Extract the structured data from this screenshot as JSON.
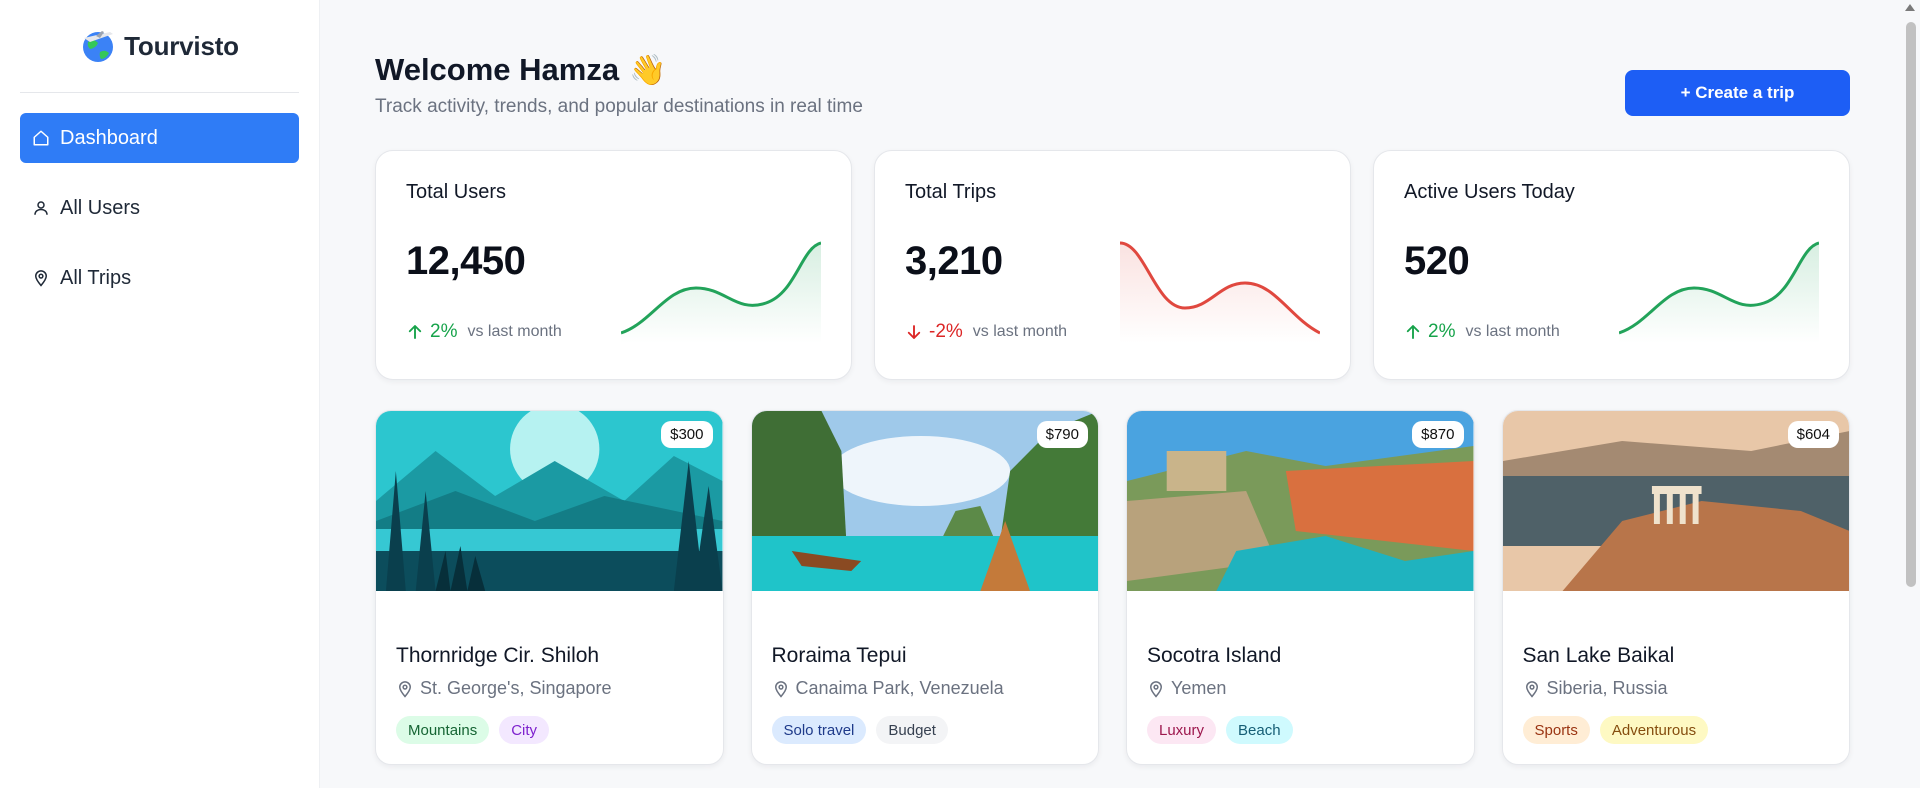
{
  "brand": {
    "name": "Tourvisto"
  },
  "sidebar": {
    "items": [
      {
        "label": "Dashboard",
        "icon": "home-icon",
        "active": true
      },
      {
        "label": "All Users",
        "icon": "user-icon",
        "active": false
      },
      {
        "label": "All Trips",
        "icon": "map-pin-icon",
        "active": false
      }
    ]
  },
  "header": {
    "title": "Welcome Hamza",
    "emoji": "👋",
    "subtitle": "Track activity, trends, and popular destinations in real time",
    "create_label": "+ Create a trip"
  },
  "stats": [
    {
      "title": "Total Users",
      "value": "12,450",
      "change": "2%",
      "direction": "up",
      "vs": "vs last month",
      "color": "#22a35a"
    },
    {
      "title": "Total Trips",
      "value": "3,210",
      "change": "-2%",
      "direction": "down",
      "vs": "vs last month",
      "color": "#e0483f"
    },
    {
      "title": "Active Users Today",
      "value": "520",
      "change": "2%",
      "direction": "up",
      "vs": "vs last month",
      "color": "#22a35a"
    }
  ],
  "trips": [
    {
      "price": "$300",
      "name": "Thornridge Cir. Shiloh",
      "location": "St. George's, Singapore",
      "tags": [
        {
          "label": "Mountains",
          "bg": "#dcfce7",
          "fg": "#166534"
        },
        {
          "label": "City",
          "bg": "#f3e8ff",
          "fg": "#7e22ce"
        }
      ]
    },
    {
      "price": "$790",
      "name": "Roraima Tepui",
      "location": "Canaima Park, Venezuela",
      "tags": [
        {
          "label": "Solo travel",
          "bg": "#dbeafe",
          "fg": "#1e3a8a"
        },
        {
          "label": "Budget",
          "bg": "#f3f4f6",
          "fg": "#374151"
        }
      ]
    },
    {
      "price": "$870",
      "name": "Socotra Island",
      "location": "Yemen",
      "tags": [
        {
          "label": "Luxury",
          "bg": "#fce7f3",
          "fg": "#9d174d"
        },
        {
          "label": "Beach",
          "bg": "#cffafe",
          "fg": "#155e75"
        }
      ]
    },
    {
      "price": "$604",
      "name": "San Lake Baikal",
      "location": "Siberia, Russia",
      "tags": [
        {
          "label": "Sports",
          "bg": "#ffedd5",
          "fg": "#9a3412"
        },
        {
          "label": "Adventurous",
          "bg": "#fef9c3",
          "fg": "#854d0e"
        }
      ]
    }
  ]
}
